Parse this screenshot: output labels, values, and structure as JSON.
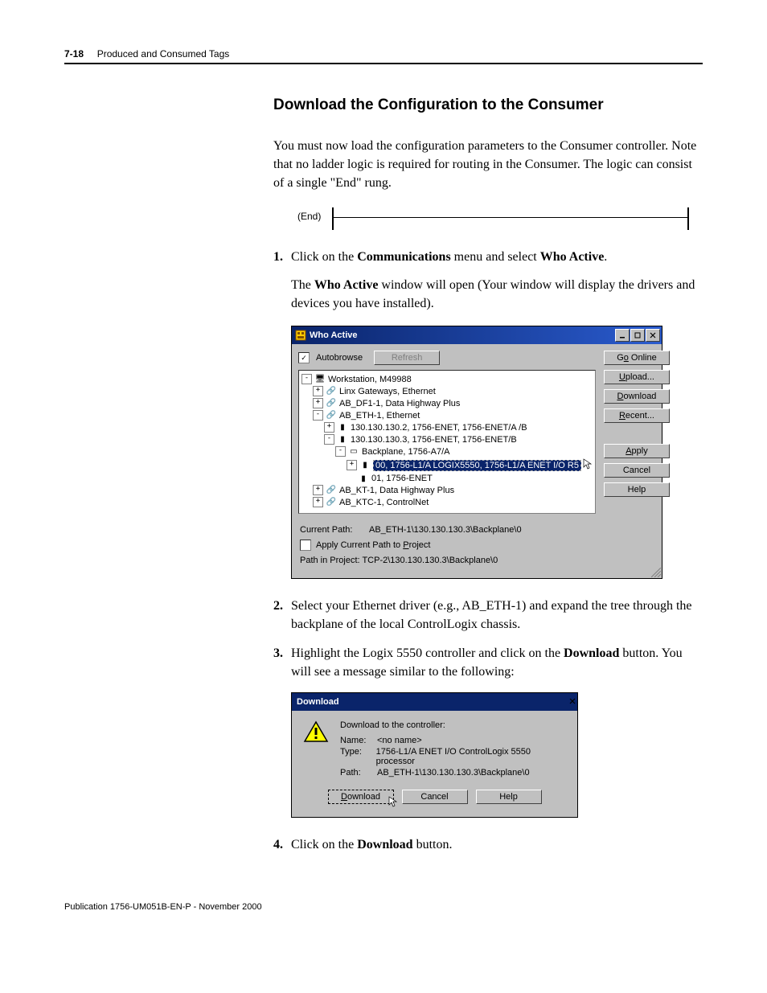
{
  "header": {
    "page_num": "7-18",
    "running": "Produced and Consumed Tags"
  },
  "section_title": "Download the Configuration to the Consumer",
  "intro_para": "You must now load the configuration parameters to the Consumer controller. Note that no ladder logic is required for routing in the Consumer. The logic can consist of a single \"End\" rung.",
  "end_label": "(End)",
  "steps": {
    "s1_num": "1.",
    "s1_pre": "Click on the ",
    "s1_bold1": "Communications",
    "s1_mid": " menu and select ",
    "s1_bold2": "Who Active",
    "s1_post": ".",
    "s1_sub_pre": "The ",
    "s1_sub_bold": "Who Active",
    "s1_sub_post": " window will open (Your window will display the drivers and devices you have installed).",
    "s2_num": "2.",
    "s2_text": "Select your Ethernet driver (e.g., AB_ETH-1) and expand the tree through the backplane of the local ControlLogix chassis.",
    "s3_num": "3.",
    "s3_pre": "Highlight the Logix 5550 controller and click on the ",
    "s3_bold": "Download",
    "s3_post": " button. You will see a message similar to the following:",
    "s4_num": "4.",
    "s4_pre": "Click on the ",
    "s4_bold": "Download",
    "s4_post": " button."
  },
  "who_active": {
    "title": "Who Active",
    "autobrowse": "Autobrowse",
    "refresh": "Refresh",
    "tree": {
      "n0": "Workstation, M49988",
      "n1": "Linx Gateways, Ethernet",
      "n2": "AB_DF1-1, Data Highway Plus",
      "n3": "AB_ETH-1, Ethernet",
      "n4": "130.130.130.2, 1756-ENET, 1756-ENET/A /B",
      "n5": "130.130.130.3, 1756-ENET, 1756-ENET/B",
      "n6": "Backplane, 1756-A7/A",
      "n7": "00, 1756-L1/A LOGIX5550, 1756-L1/A ENET I/O R5",
      "n8": "01, 1756-ENET",
      "n9": "AB_KT-1, Data Highway Plus",
      "n10": "AB_KTC-1, ControlNet"
    },
    "buttons": {
      "go_online": "Go Online",
      "upload": "Upload...",
      "download": "Download",
      "recent": "Recent...",
      "apply": "Apply",
      "cancel": "Cancel",
      "help": "Help"
    },
    "bottom": {
      "current_path_lbl": "Current Path:",
      "current_path_val": "AB_ETH-1\\130.130.130.3\\Backplane\\0",
      "apply_path": "Apply Current Path to Project",
      "path_in_project": "Path in Project: TCP-2\\130.130.130.3\\Backplane\\0"
    }
  },
  "download_dialog": {
    "title": "Download",
    "message": "Download to the controller:",
    "name_lbl": "Name:",
    "name_val": "<no name>",
    "type_lbl": "Type:",
    "type_val": "1756-L1/A ENET I/O ControlLogix 5550 processor",
    "path_lbl": "Path:",
    "path_val": "AB_ETH-1\\130.130.130.3\\Backplane\\0",
    "download_btn": "Download",
    "cancel_btn": "Cancel",
    "help_btn": "Help"
  },
  "footer": "Publication 1756-UM051B-EN-P - November 2000"
}
